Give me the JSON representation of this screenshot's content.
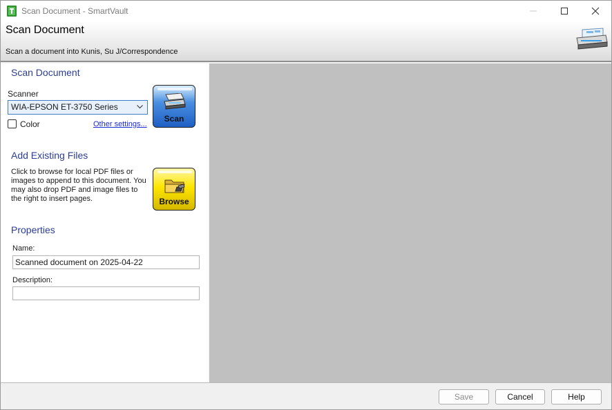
{
  "window": {
    "title": "Scan Document - SmartVault"
  },
  "header": {
    "title": "Scan Document",
    "subtitle": "Scan a document into Kunis, Su J/Correspondence"
  },
  "scan_section": {
    "title": "Scan Document",
    "scanner_label": "Scanner",
    "scanner_selected": "WIA-EPSON ET-3750 Series",
    "color_label": "Color",
    "color_checked": false,
    "other_settings_link": "Other settings...",
    "scan_button_label": "Scan"
  },
  "files_section": {
    "title": "Add Existing Files",
    "description": "Click to browse for local PDF files or images to append to this document.  You may also drop PDF and image files to the right to insert pages.",
    "browse_button_label": "Browse"
  },
  "properties": {
    "title": "Properties",
    "name_label": "Name:",
    "name_value": "Scanned document on 2025-04-22",
    "description_label": "Description:",
    "description_value": ""
  },
  "footer": {
    "save_label": "Save",
    "cancel_label": "Cancel",
    "help_label": "Help"
  },
  "colors": {
    "section_title": "#2b3d94",
    "link": "#1a2bd6",
    "preview_bg": "#c0c0c0",
    "select_focus": "#3f7dc9"
  },
  "icons": {
    "app": "smartvault-logo-icon",
    "minimize": "minimize-icon",
    "maximize": "maximize-icon",
    "close": "close-icon",
    "header": "scanner-illustration-icon",
    "scan": "scanner-icon",
    "browse": "folder-icon",
    "dropdown": "chevron-down-icon"
  }
}
